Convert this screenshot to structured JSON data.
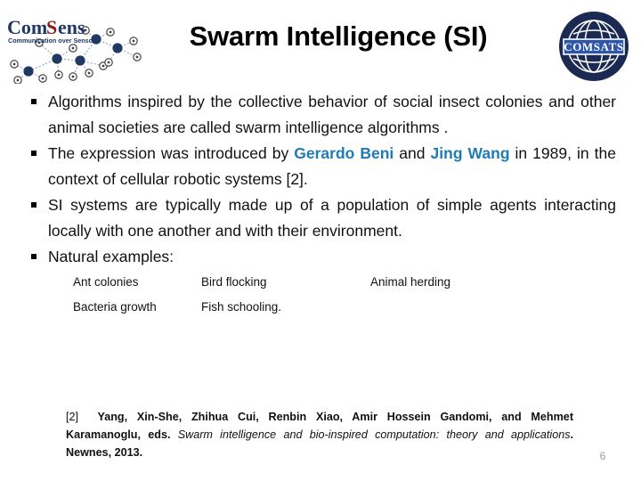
{
  "header": {
    "title": "Swarm Intelligence (SI)",
    "left_logo": {
      "name": "ComSens",
      "word_com": "Com",
      "word_s": "S",
      "word_ens": "ens",
      "tagline": "Communication over Sensors",
      "navy": "#1F3864",
      "red": "#8B1A1A"
    },
    "right_logo": {
      "name": "COMSATS",
      "banner_text": "COMSATS",
      "navy": "#1B2A52",
      "banner_blue": "#2E56A8"
    }
  },
  "bullets": [
    {
      "marker": "square",
      "text": "Algorithms inspired by the collective behavior of social insect colonies and other animal societies are called swarm intelligence algorithms ."
    },
    {
      "marker": "square",
      "pre": "The expression was introduced by ",
      "name1": "Gerardo Beni",
      "mid": " and ",
      "name2": "Jing Wang",
      "post": " in 1989, in the context of cellular robotic systems [2]."
    },
    {
      "marker": "square",
      "text": "SI systems are typically made up of a population of simple agents interacting locally with one another and with their environment."
    },
    {
      "marker": "square",
      "text": "Natural examples:"
    }
  ],
  "accent_blue": "#1F7BB6",
  "examples": {
    "rows": [
      [
        "Ant colonies",
        "Bird flocking",
        "Animal herding"
      ],
      [
        "Bacteria growth",
        "Fish schooling.",
        ""
      ]
    ]
  },
  "citation": {
    "ref": "[2]",
    "authors": "Yang, Xin-She, Zhihua Cui, Renbin Xiao, Amir Hossein Gandomi, and Mehmet Karamanoglu,",
    "eds": "eds.",
    "title_italic": "Swarm intelligence and bio-inspired computation: theory and applications",
    "publisher": ". Newnes, 2013."
  },
  "page_number": "6"
}
